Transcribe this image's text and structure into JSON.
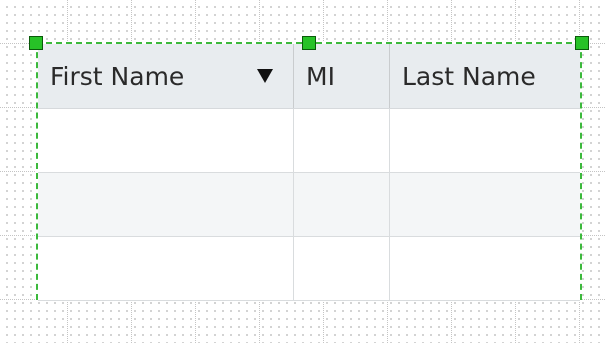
{
  "table": {
    "columns": [
      {
        "label": "First Name",
        "sortable": true,
        "sort_icon": "sort-descending-icon"
      },
      {
        "label": "MI"
      },
      {
        "label": "Last Name"
      }
    ],
    "rows": [
      [
        "",
        "",
        ""
      ],
      [
        "",
        "",
        ""
      ],
      [
        "",
        "",
        ""
      ]
    ]
  },
  "colors": {
    "selection": "#27c227",
    "header_bg": "#e8ecef",
    "alt_row_bg": "#f4f6f7"
  }
}
